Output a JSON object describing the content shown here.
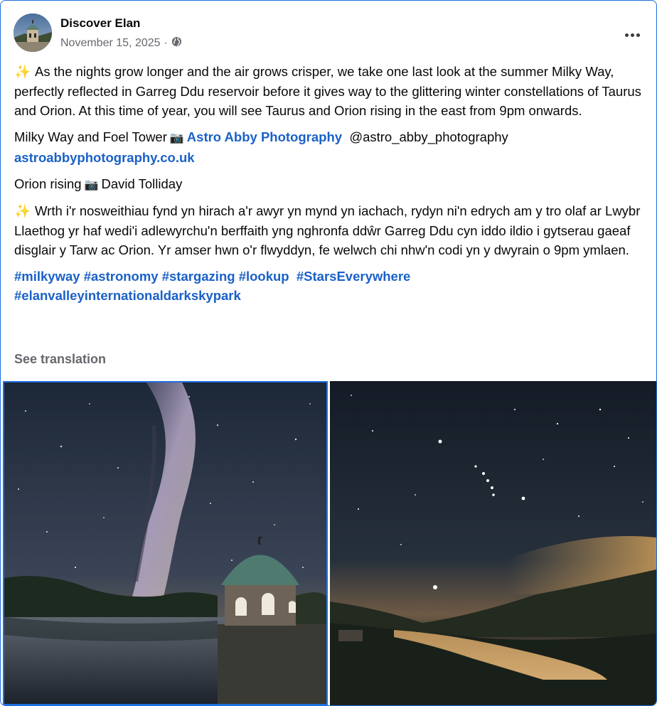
{
  "post": {
    "author": "Discover Elan",
    "date": "November 15, 2025",
    "separator": "·",
    "audience_icon": "globe-icon",
    "more_icon": "more-options-icon",
    "paragraphs": {
      "p1": "As the nights grow longer and the air grows crisper, we take one last look at the summer Milky Way, perfectly reflected in Garreg Ddu reservoir before it gives way to the glittering winter constellations of Taurus and Orion. At this time of year, you will see Taurus and Orion rising in the east from 9pm onwards.",
      "p2_prefix": "Milky Way and Foel Tower",
      "p2_link": "Astro Abby Photography",
      "p2_handle": "@astro_abby_photography",
      "p2_site": "astroabbyphotography.co.uk",
      "p3_prefix": "Orion rising",
      "p3_name": "David Tolliday",
      "p4": "Wrth i'r nosweithiau fynd yn hirach a'r awyr yn mynd yn iachach, rydyn ni'n edrych am y tro olaf ar Lwybr Llaethog yr haf wedi'i adlewyrchu'n berffaith yng nghronfa ddŵr Garreg Ddu cyn iddo ildio i gytserau gaeaf disglair y Tarw ac Orion. Yr amser hwn o'r flwyddyn, fe welwch chi nhw'n codi yn y dwyrain o 9pm ymlaen."
    },
    "sparkle": "✨",
    "camera": "📷",
    "hashtags": [
      "#milkyway",
      "#astronomy",
      "#stargazing",
      "#lookup",
      "#StarsEverywhere",
      "#elanvalleyinternationaldarkskypark"
    ],
    "see_translation": "See translation"
  },
  "colors": {
    "link": "#1a61c7",
    "meta": "#65686c",
    "selection": "#1f6fe0"
  }
}
